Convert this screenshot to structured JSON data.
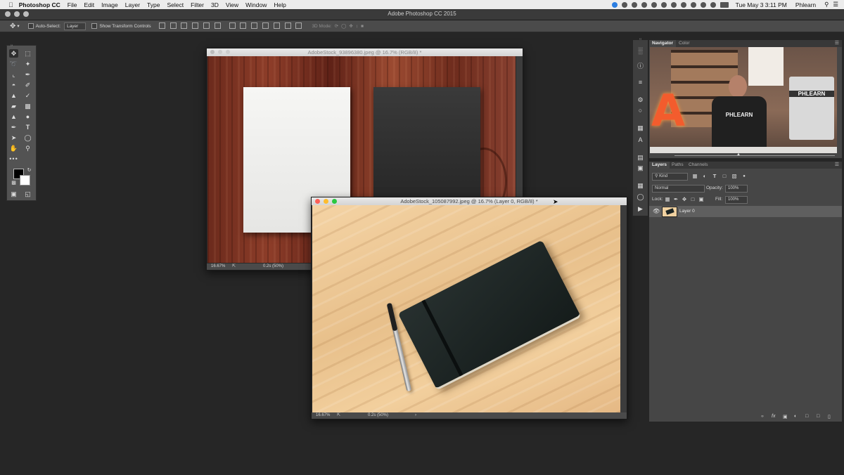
{
  "menubar": {
    "app_name": "Photoshop CC",
    "items": [
      "File",
      "Edit",
      "Image",
      "Layer",
      "Type",
      "Select",
      "Filter",
      "3D",
      "View",
      "Window",
      "Help"
    ],
    "clock": "Tue May 3  3:11 PM",
    "user": "Phlearn"
  },
  "window": {
    "title": "Adobe Photoshop CC 2015"
  },
  "options": {
    "auto_select_label": "Auto-Select:",
    "auto_select_value": "Layer",
    "show_transform_label": "Show Transform Controls",
    "mode_label": "3D Mode:"
  },
  "doc1": {
    "title": "AdobeStock_93896380.jpeg @ 16.7% (RGB/8) *",
    "zoom": "16.67%",
    "info": "0.2s (50%)"
  },
  "doc2": {
    "title": "AdobeStock_105087992.jpeg @ 16.7% (Layer 0, RGB/8) *",
    "zoom": "16.67%",
    "info": "0.2s (50%)"
  },
  "navigator": {
    "tabs": [
      "Navigator",
      "Color"
    ],
    "sign_text": "PHLEARN",
    "shirt_text": "PHLEARN"
  },
  "layers": {
    "tabs": [
      "Layers",
      "Paths",
      "Channels"
    ],
    "filter_kind": "Kind",
    "blend_mode": "Normal",
    "opacity_label": "Opacity:",
    "opacity_value": "100%",
    "lock_label": "Lock:",
    "fill_label": "Fill:",
    "fill_value": "100%",
    "rows": [
      {
        "name": "Layer 0"
      }
    ]
  },
  "colors": {
    "workspace": "#262626",
    "panel": "#464646",
    "selected_row": "#5f5f5f",
    "notebook": "#1d2524"
  }
}
